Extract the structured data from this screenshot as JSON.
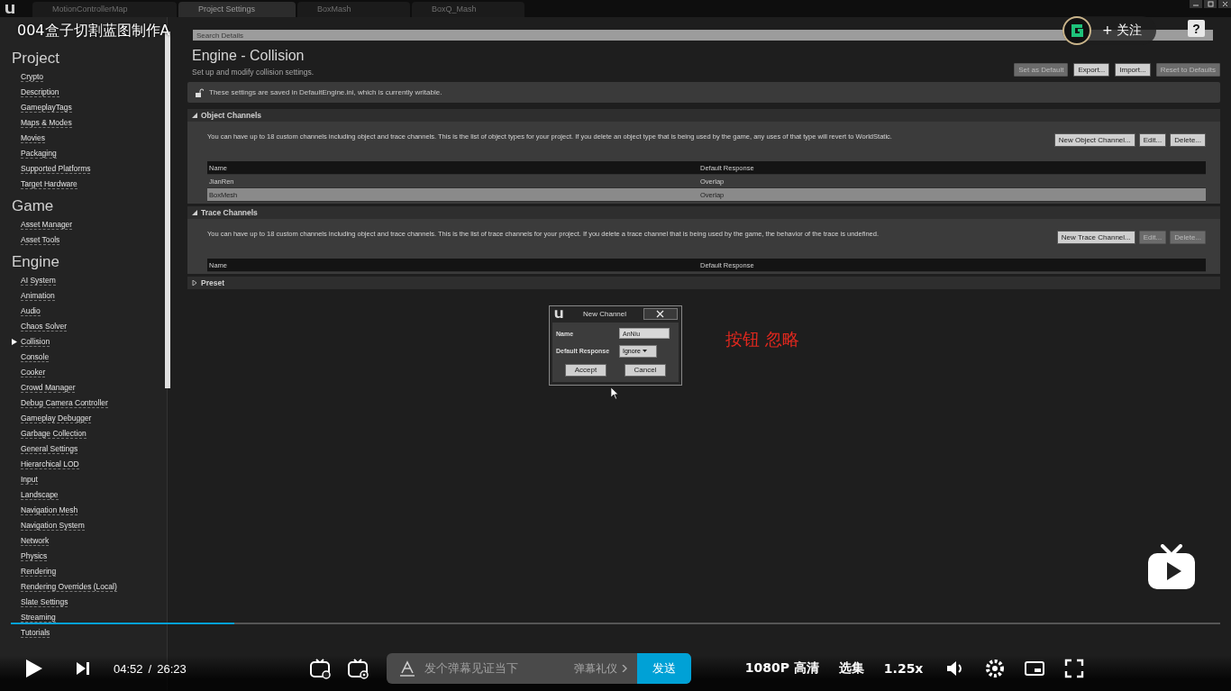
{
  "editor_tabs": [
    {
      "label": "MotionControllerMap",
      "selected": false
    },
    {
      "label": "Project Settings",
      "selected": true
    },
    {
      "label": "BoxMash",
      "selected": false
    },
    {
      "label": "BoxQ_Mash",
      "selected": false
    }
  ],
  "player": {
    "title": "004盒子切割蓝图制作A",
    "follow": "+ 关注",
    "help": "?"
  },
  "sidebar": {
    "sections": [
      {
        "title": "Project",
        "items": [
          {
            "label": "Crypto",
            "selected": false
          },
          {
            "label": "Description",
            "selected": false
          },
          {
            "label": "GameplayTags",
            "selected": false
          },
          {
            "label": "Maps & Modes",
            "selected": false
          },
          {
            "label": "Movies",
            "selected": false
          },
          {
            "label": "Packaging",
            "selected": false
          },
          {
            "label": "Supported Platforms",
            "selected": false
          },
          {
            "label": "Target Hardware",
            "selected": false
          }
        ]
      },
      {
        "title": "Game",
        "items": [
          {
            "label": "Asset Manager",
            "selected": false
          },
          {
            "label": "Asset Tools",
            "selected": false
          }
        ]
      },
      {
        "title": "Engine",
        "items": [
          {
            "label": "AI System",
            "selected": false
          },
          {
            "label": "Animation",
            "selected": false
          },
          {
            "label": "Audio",
            "selected": false
          },
          {
            "label": "Chaos Solver",
            "selected": false
          },
          {
            "label": "Collision",
            "selected": true
          },
          {
            "label": "Console",
            "selected": false
          },
          {
            "label": "Cooker",
            "selected": false
          },
          {
            "label": "Crowd Manager",
            "selected": false
          },
          {
            "label": "Debug Camera Controller",
            "selected": false
          },
          {
            "label": "Gameplay Debugger",
            "selected": false
          },
          {
            "label": "Garbage Collection",
            "selected": false
          },
          {
            "label": "General Settings",
            "selected": false
          },
          {
            "label": "Hierarchical LOD",
            "selected": false
          },
          {
            "label": "Input",
            "selected": false
          },
          {
            "label": "Landscape",
            "selected": false
          },
          {
            "label": "Navigation Mesh",
            "selected": false
          },
          {
            "label": "Navigation System",
            "selected": false
          },
          {
            "label": "Network",
            "selected": false
          },
          {
            "label": "Physics",
            "selected": false
          },
          {
            "label": "Rendering",
            "selected": false
          },
          {
            "label": "Rendering Overrides (Local)",
            "selected": false
          },
          {
            "label": "Slate Settings",
            "selected": false
          },
          {
            "label": "Streaming",
            "selected": false
          },
          {
            "label": "Tutorials",
            "selected": false
          }
        ]
      }
    ]
  },
  "details": {
    "search_placeholder": "Search Details",
    "title": "Engine - Collision",
    "subtitle": "Set up and modify collision settings.",
    "actions": [
      {
        "label": "Set as Default",
        "disabled": true
      },
      {
        "label": "Export...",
        "disabled": false
      },
      {
        "label": "Import...",
        "disabled": false
      },
      {
        "label": "Reset to Defaults",
        "disabled": true
      }
    ],
    "notice": "These settings are saved in DefaultEngine.ini, which is currently writable."
  },
  "categories": [
    {
      "title": "Object Channels",
      "expanded": true,
      "description": "You can have up to 18 custom channels including object and trace channels. This is the list of object types for your project. If you delete an object type that is being used by the game, any uses of that type will revert to WorldStatic.",
      "buttons": [
        {
          "label": "New Object Channel...",
          "disabled": false
        },
        {
          "label": "Edit...",
          "disabled": false
        },
        {
          "label": "Delete...",
          "disabled": false
        }
      ],
      "columns": [
        "Name",
        "Default Response"
      ],
      "rows": [
        {
          "cells": [
            "JianRen",
            "Overlap"
          ],
          "selected": false
        },
        {
          "cells": [
            "BoxMesh",
            "Overlap"
          ],
          "selected": true
        }
      ]
    },
    {
      "title": "Trace Channels",
      "expanded": true,
      "description": "You can have up to 18 custom channels including object and trace channels. This is the list of trace channels for your project. If you delete a trace channel that is being used by the game, the behavior of the trace is undefined.",
      "buttons": [
        {
          "label": "New Trace Channel...",
          "disabled": false
        },
        {
          "label": "Edit...",
          "disabled": true
        },
        {
          "label": "Delete...",
          "disabled": true
        }
      ],
      "columns": [
        "Name",
        "Default Response"
      ]
    },
    {
      "title": "Preset",
      "expanded": false
    }
  ],
  "dialog": {
    "title": "New Channel",
    "name_label": "Name",
    "name_value": "AnNiu",
    "response_label": "Default Response",
    "response_value": "Ignore",
    "buttons": [
      "Accept",
      "Cancel"
    ]
  },
  "annotation": "按钮 忽略",
  "controls": {
    "level": 0.185,
    "time": "04:52",
    "separator": "/",
    "duration": "26:23",
    "danmaku_placeholder": "发个弹幕见证当下",
    "etiquette": "弹幕礼仪",
    "send": "发送",
    "quality": "1080P 高清",
    "episodes": "选集",
    "speed": "1.25x"
  }
}
